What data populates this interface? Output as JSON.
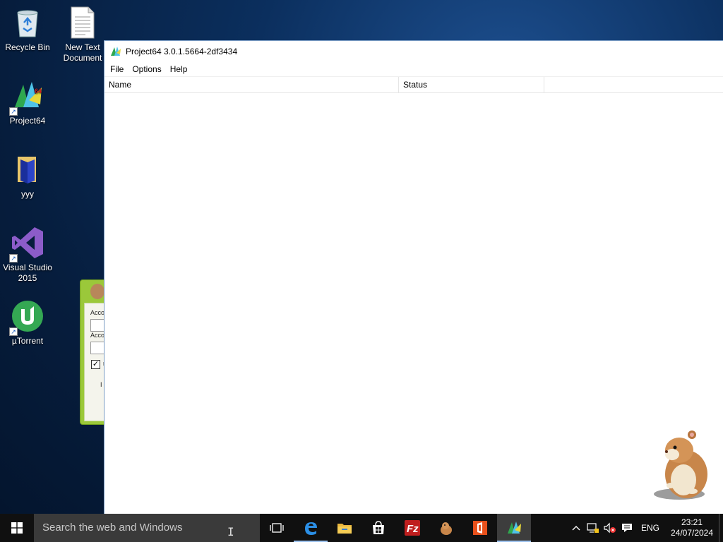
{
  "desktop": {
    "icons": [
      {
        "label": "Recycle Bin",
        "icon": "recycle-bin-icon"
      },
      {
        "label": "New Text Document",
        "icon": "text-document-icon"
      },
      {
        "label": "Project64",
        "icon": "project64-icon"
      },
      {
        "label": "yyy",
        "icon": "folder-icon"
      },
      {
        "label": "Visual Studio 2015",
        "icon": "visual-studio-icon"
      },
      {
        "label": "µTorrent",
        "icon": "utorrent-icon"
      }
    ]
  },
  "background_window": {
    "label1": "Acco",
    "label2": "Acco",
    "checkbox_mark": "✓",
    "checkbox_label": "r",
    "extra_text": "I",
    "accent_color": "#9bc83a"
  },
  "app_window": {
    "title": "Project64 3.0.1.5664-2df3434",
    "menu": [
      "File",
      "Options",
      "Help"
    ],
    "columns": [
      "Name",
      "Status"
    ]
  },
  "taskbar": {
    "search_placeholder": "Search the web and Windows",
    "pinned": [
      "task-view-icon",
      "edge-icon",
      "file-explorer-icon",
      "store-icon",
      "filezilla-icon",
      "hamster-app-icon",
      "office-icon",
      "project64-icon"
    ],
    "tray": {
      "language": "ENG",
      "time": "23:21",
      "date": "24/07/2024"
    }
  }
}
